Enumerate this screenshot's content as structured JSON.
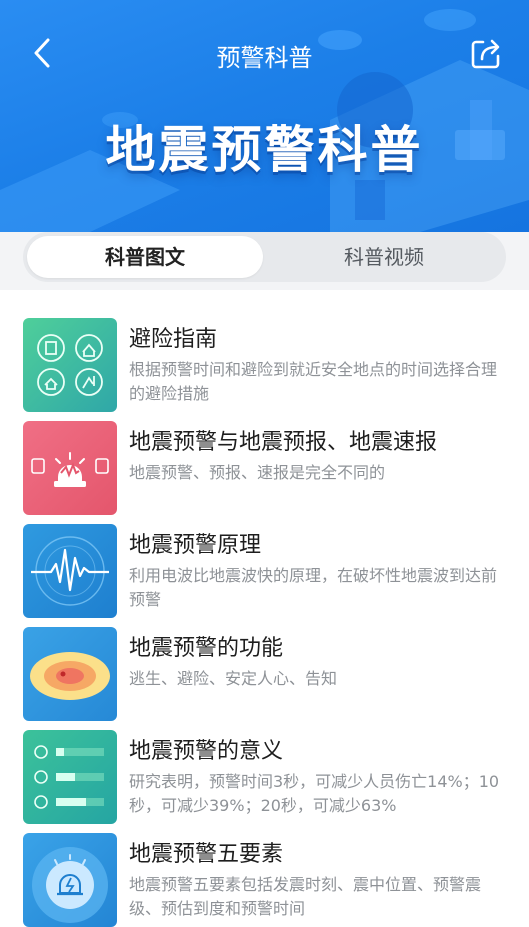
{
  "nav": {
    "title": "预警科普"
  },
  "banner": {
    "title": "地震预警科普"
  },
  "tabs": [
    {
      "label": "科普图文",
      "active": true
    },
    {
      "label": "科普视频",
      "active": false
    }
  ],
  "items": [
    {
      "title": "避险指南",
      "desc": "根据预警时间和避险到就近安全地点的时间选择合理的避险措施",
      "thumb": "shelter-guide-icon"
    },
    {
      "title": "地震预警与地震预报、地震速报",
      "desc": "地震预警、预报、速报是完全不同的",
      "thumb": "alarm-light-icon"
    },
    {
      "title": "地震预警原理",
      "desc": "利用电波比地震波快的原理，在破坏性地震波到达前预警",
      "thumb": "seismic-wave-icon"
    },
    {
      "title": "地震预警的功能",
      "desc": "逃生、避险、安定人心、告知",
      "thumb": "intensity-map-icon"
    },
    {
      "title": "地震预警的意义",
      "desc": "研究表明，预警时间3秒，可减少人员伤亡14%；10秒，可减少39%；20秒，可减少63%",
      "thumb": "timer-bars-icon"
    },
    {
      "title": "地震预警五要素",
      "desc": "地震预警五要素包括发震时刻、震中位置、预警震级、预估到度和预警时间",
      "thumb": "alarm-dial-icon"
    }
  ],
  "colors": {
    "accent": "#1c7fe8",
    "green": "#3fbf8f",
    "red": "#ea6077",
    "blue": "#2a8fd6"
  }
}
